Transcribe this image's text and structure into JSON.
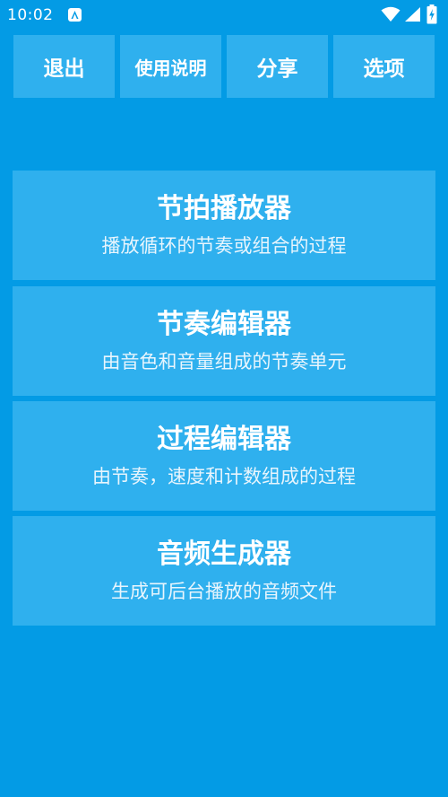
{
  "status_bar": {
    "time": "10:02",
    "icons": [
      "notification-a-icon",
      "wifi-icon",
      "cell-signal-icon",
      "battery-icon"
    ]
  },
  "toolbar": {
    "exit_label": "退出",
    "help_label": "使用说明",
    "share_label": "分享",
    "options_label": "选项"
  },
  "cards": [
    {
      "title": "节拍播放器",
      "description": "播放循环的节奏或组合的过程"
    },
    {
      "title": "节奏编辑器",
      "description": "由音色和音量组成的节奏单元"
    },
    {
      "title": "过程编辑器",
      "description": "由节奏，速度和计数组成的过程"
    },
    {
      "title": "音频生成器",
      "description": "生成可后台播放的音频文件"
    }
  ],
  "colors": {
    "background": "#039be5",
    "button": "#2fb0ee",
    "text": "#ffffff"
  }
}
